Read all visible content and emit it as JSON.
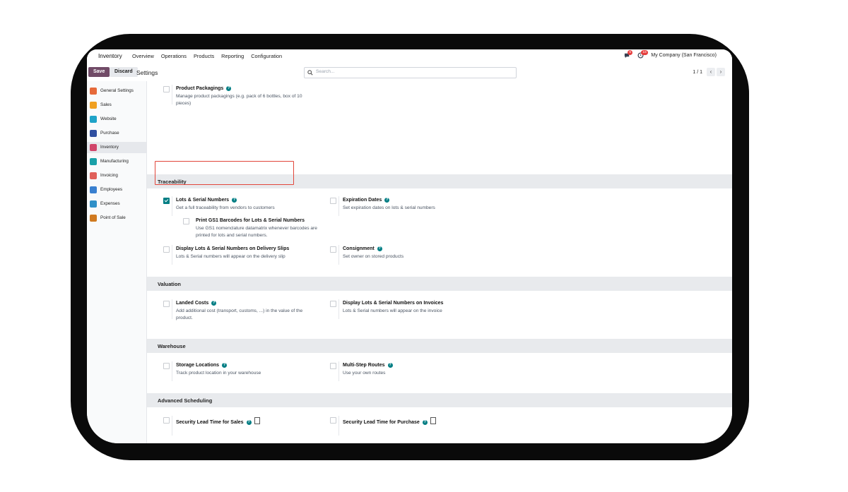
{
  "nav": {
    "app": "Inventory",
    "menu": [
      "Overview",
      "Operations",
      "Products",
      "Reporting",
      "Configuration"
    ],
    "messages_badge": "6",
    "activity_badge": "18",
    "company": "My Company (San Francisco)"
  },
  "control": {
    "save": "Save",
    "discard": "Discard",
    "title": "Settings",
    "search_placeholder": "Search...",
    "pager": "1 / 1"
  },
  "sidebar": {
    "items": [
      {
        "label": "General Settings",
        "color": "#e66a3a"
      },
      {
        "label": "Sales",
        "color": "#f0a020"
      },
      {
        "label": "Website",
        "color": "#1fa3c8"
      },
      {
        "label": "Purchase",
        "color": "#2f4fa0"
      },
      {
        "label": "Inventory",
        "color": "#d1456a"
      },
      {
        "label": "Manufacturing",
        "color": "#1aa0a8"
      },
      {
        "label": "Invoicing",
        "color": "#e0605a"
      },
      {
        "label": "Employees",
        "color": "#3a80d0"
      },
      {
        "label": "Expenses",
        "color": "#2f90c8"
      },
      {
        "label": "Point of Sale",
        "color": "#d07a20"
      }
    ],
    "active_index": 4
  },
  "sections": {
    "traceability": "Traceability",
    "valuation": "Valuation",
    "warehouse": "Warehouse",
    "advanced": "Advanced Scheduling"
  },
  "settings": {
    "packaging": {
      "name": "Product Packagings",
      "desc": "Manage product packagings (e.g. pack of 6 bottles, box of 10 pieces)",
      "checked": false
    },
    "lots": {
      "name": "Lots & Serial Numbers",
      "desc": "Get a full traceability from vendors to customers",
      "checked": true
    },
    "expiration": {
      "name": "Expiration Dates",
      "desc": "Set expiration dates on lots & serial numbers",
      "checked": false
    },
    "gs1": {
      "name": "Print GS1 Barcodes for Lots & Serial Numbers",
      "desc": "Use GS1 nomenclature datamatrix whenever barcodes are printed for lots and serial numbers.",
      "checked": false
    },
    "display_delivery": {
      "name": "Display Lots & Serial Numbers on Delivery Slips",
      "desc": "Lots & Serial numbers will appear on the delivery slip",
      "checked": false
    },
    "consignment": {
      "name": "Consignment",
      "desc": "Set owner on stored products",
      "checked": false
    },
    "landed": {
      "name": "Landed Costs",
      "desc": "Add additional cost (transport, customs, ...) in the value of the product.",
      "checked": false
    },
    "display_invoices": {
      "name": "Display Lots & Serial Numbers on Invoices",
      "desc": "Lots & Serial numbers will appear on the invoice",
      "checked": false
    },
    "storage": {
      "name": "Storage Locations",
      "desc": "Track product location in your warehouse",
      "checked": false
    },
    "multistep": {
      "name": "Multi-Step Routes",
      "desc": "Use your own routes",
      "checked": false
    },
    "lead_sales": {
      "name": "Security Lead Time for Sales",
      "checked": false
    },
    "lead_purchase": {
      "name": "Security Lead Time for Purchase",
      "checked": false
    }
  }
}
